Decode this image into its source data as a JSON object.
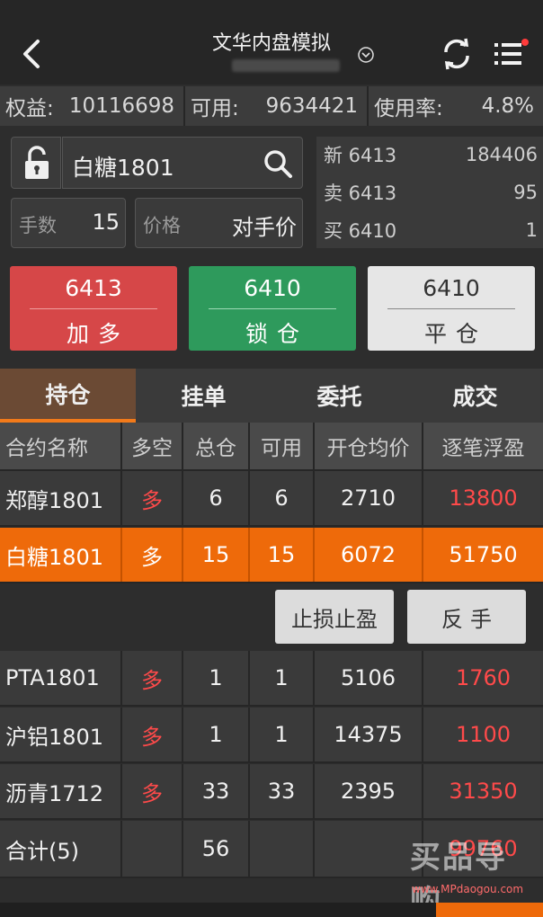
{
  "header": {
    "title": "文华内盘模拟",
    "back_icon": "back-arrow",
    "refresh_icon": "refresh",
    "menu_icon": "menu-with-dot"
  },
  "stats": [
    {
      "label": "权益:",
      "value": "10116698"
    },
    {
      "label": "可用:",
      "value": "9634421"
    },
    {
      "label": "使用率:",
      "value": "4.8%"
    }
  ],
  "order": {
    "symbol": "白糖1801",
    "qty_label": "手数",
    "qty_value": "15",
    "price_label": "价格",
    "price_value": "对手价"
  },
  "quote": [
    {
      "label": "新 6413",
      "value": "184406"
    },
    {
      "label": "卖 6413",
      "value": "95"
    },
    {
      "label": "买 6410",
      "value": "1"
    }
  ],
  "actions": [
    {
      "price": "6413",
      "label": "加多"
    },
    {
      "price": "6410",
      "label": "锁仓"
    },
    {
      "price": "6410",
      "label": "平仓"
    }
  ],
  "tabs": [
    "持仓",
    "挂单",
    "委托",
    "成交"
  ],
  "table": {
    "headers": [
      "合约名称",
      "多空",
      "总仓",
      "可用",
      "开仓均价",
      "逐笔浮盈"
    ],
    "rows": [
      [
        "郑醇1801",
        "多",
        "6",
        "6",
        "2710",
        "13800"
      ],
      [
        "白糖1801",
        "多",
        "15",
        "15",
        "6072",
        "51750"
      ],
      [
        "PTA1801",
        "多",
        "1",
        "1",
        "5106",
        "1760"
      ],
      [
        "沪铝1801",
        "多",
        "1",
        "1",
        "14375",
        "1100"
      ],
      [
        "沥青1712",
        "多",
        "33",
        "33",
        "2395",
        "31350"
      ],
      [
        "合计(5)",
        "",
        "56",
        "",
        "",
        "99760"
      ]
    ]
  },
  "row_actions": [
    "止损止盈",
    "反手"
  ],
  "watermark": {
    "text": "买品导购",
    "url": "www.MPdaogou.com"
  },
  "colors": {
    "accent": "#ee6a0a",
    "red": "#d64748",
    "green": "#2e9a5c",
    "loss_text": "#ff4a4a"
  }
}
